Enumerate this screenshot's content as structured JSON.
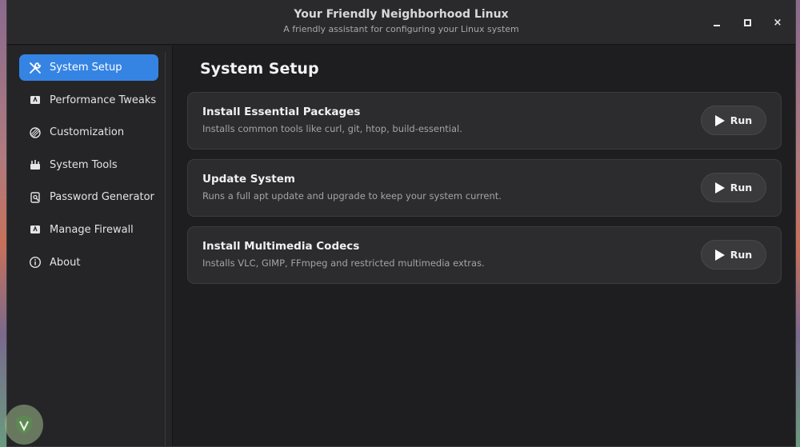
{
  "window": {
    "title": "Your Friendly Neighborhood Linux",
    "subtitle": "A friendly assistant for configuring your Linux system",
    "controls": {
      "minimize": "minimize-icon",
      "maximize": "maximize-icon",
      "close": "×"
    }
  },
  "sidebar": {
    "items": [
      {
        "label": "System Setup",
        "icon": "wrench-screwdriver-icon",
        "active": true
      },
      {
        "label": "Performance Tweaks",
        "icon": "performance-icon",
        "active": false
      },
      {
        "label": "Customization",
        "icon": "palette-icon",
        "active": false
      },
      {
        "label": "System Tools",
        "icon": "toolbox-icon",
        "active": false
      },
      {
        "label": "Password Generator",
        "icon": "password-icon",
        "active": false
      },
      {
        "label": "Manage Firewall",
        "icon": "firewall-icon",
        "active": false
      },
      {
        "label": "About",
        "icon": "info-icon",
        "active": false
      }
    ]
  },
  "main": {
    "title": "System Setup",
    "cards": [
      {
        "title": "Install Essential Packages",
        "description": "Installs common tools like curl, git, htop, build-essential.",
        "button": "Run"
      },
      {
        "title": "Update System",
        "description": "Runs a full apt update and upgrade to keep your system current.",
        "button": "Run"
      },
      {
        "title": "Install Multimedia Codecs",
        "description": "Installs VLC, GIMP, FFmpeg and restricted multimedia extras.",
        "button": "Run"
      }
    ]
  },
  "colors": {
    "accent": "#3584e4",
    "window_bg": "#1e1e20",
    "card_bg": "#2c2c2e"
  }
}
